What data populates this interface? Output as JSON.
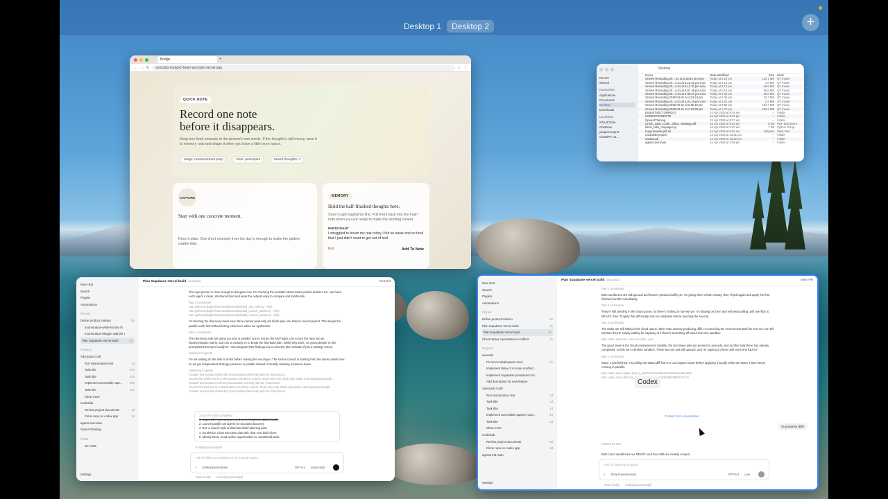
{
  "spaces": {
    "desktop1": "Desktop 1",
    "desktop2": "Desktop 2",
    "add": "+"
  },
  "browser": {
    "tab_title": "Bridge",
    "url": "avocado-nunigv1-team-avocado.vercel.app",
    "quick_note": {
      "pill": "QUICK NOTE",
      "title": "Record one note before it disappears.",
      "body": "Keep one lived example in the person's own words. If the thought is still messy, save it to memory now and shape it when you have a little more space.",
      "tags": [
        "Stage: reassessment prep",
        "Role: participant",
        "Saved thoughts: 7"
      ]
    },
    "capture": {
      "pill": "CAPTURE",
      "title": "Start with one concrete moment.",
      "body": "Keep it plain. One short example from the day is enough to make the pattern usable later."
    },
    "memory": {
      "pill": "MEMORY",
      "title": "Hold the half-finished thoughts here.",
      "body": "Save rough fragments first. Pull them back into the main note when you are ready to make the wording clearer.",
      "participant_label": "PARTICIPANT",
      "quote": "I struggled to brush my hair today I felt so weak and so tired that I just didn't want to get out of bed",
      "input_text": "test",
      "add_button": "Add To Note"
    }
  },
  "finder": {
    "title": "Desktop",
    "sidebar": [
      {
        "label": "Recent",
        "type": "item"
      },
      {
        "label": "Shared",
        "type": "item"
      },
      {
        "label": "Favourites",
        "type": "section"
      },
      {
        "label": "Applications",
        "type": "item"
      },
      {
        "label": "Documents",
        "type": "item"
      },
      {
        "label": "Desktop",
        "type": "selected"
      },
      {
        "label": "Downloads",
        "type": "item"
      },
      {
        "label": "Locations",
        "type": "section"
      },
      {
        "label": "iCloud Drive",
        "type": "item"
      },
      {
        "label": "OneDrive",
        "type": "item"
      },
      {
        "label": "jacquesresprot",
        "type": "item"
      },
      {
        "label": "ChatGPT Us...",
        "type": "item"
      }
    ],
    "columns": [
      "Name",
      "Date Modified",
      "Size",
      "Kind"
    ],
    "rows": [
      [
        "Screen Recording 20...-21 at 5.16.54 pm.mov",
        "Today at 5:20 pm",
        "132.1 MB",
        "QT movie"
      ],
      [
        "Screen Recording 20...4-21 at 5.16.21 pm.mov",
        "Today at 5:18 pm",
        "4.6 MB",
        "QT movie"
      ],
      [
        "Screen Recording 20...4-21 at 5.11.15 pm.mov",
        "Today at 5:13 pm",
        "56.6 MB",
        "QT movie"
      ],
      [
        "Screen Recording 20...4-21 at 5.07.49 pm.mov",
        "Today at 5:10 pm",
        "66.8 MB",
        "QT movie"
      ],
      [
        "Screen Recording 20...4-21 at 4.38.47 pm.mov",
        "Today at 4:40 pm",
        "26.6 MB",
        "QT movie"
      ],
      [
        "Screen Recording 2026-04-21 at 4.33.24 pm",
        "Today at 4:35 pm",
        "33.7 MB",
        "QT movie"
      ],
      [
        "Screen Recording 20...4-21 at 3.01.19 pm.mov",
        "Today at 3:01 pm",
        "2.2 MB",
        "QT movie"
      ],
      [
        "Screen Recording 2026-04-21 at 2.35.19 pm",
        "Today at 2:59 pm",
        "234.7 MB",
        "QT movie"
      ],
      [
        "Screen Recording 2026-04-21 at 1.34.30 pm",
        "Today at 1:47 pm",
        "299.2 MB",
        "QT movie"
      ],
      [
        "EIGENTVECTORROOT",
        "14 Apr 2026 at 8:18 am",
        "--",
        "Folder"
      ],
      [
        "CODEXPROJECTS",
        "15 Apr 2026 at 6:38 pm",
        "--",
        "Folder"
      ],
      [
        "OpenAITraining",
        "15 Apr 2026 at 9:37 am",
        "--",
        "Folder"
      ],
      [
        "Limon_Labs_Code...ollout_Strategy.pdf",
        "15 Apr 2026 at 9:33 am",
        "5 KB",
        "PDF Document"
      ],
      [
        "limon_labs_onepager.py",
        "15 Apr 2026 at 9:30 am",
        "7 KB",
        "Python Script"
      ],
      [
        "requirements.pdf.txt",
        "15 Apr 2026 at 9:30 am",
        "18 bytes",
        "Plain Text"
      ],
      [
        "Codexlab-project",
        "13 Apr 2026 at 12:51 pm",
        "--",
        "Folder"
      ],
      [
        "CodexLab",
        "13 Apr 2026 at 12:52 pm",
        "--",
        "Folder"
      ],
      [
        "agents.md-main",
        "15 Apr 2026 at 4:08 pm",
        "--",
        "Folder"
      ]
    ]
  },
  "codex_left": {
    "header_title": "Plan Supabase Vercel build",
    "header_sub": "avocado",
    "commit": "Commit",
    "sidebar": [
      {
        "label": "New chat",
        "type": "item"
      },
      {
        "label": "Search",
        "type": "item"
      },
      {
        "label": "Plugins",
        "type": "item"
      },
      {
        "label": "Automations",
        "type": "item"
      },
      {
        "label": "Pinned",
        "type": "section"
      },
      {
        "label": "Define product mission",
        "t": "5h",
        "type": "item"
      },
      {
        "label": "murmuration-white-hat the th",
        "t": "",
        "type": "indent"
      },
      {
        "label": "murmuration-blogger add the t",
        "t": "",
        "type": "indent"
      },
      {
        "label": "Plan Supabase Vercel build",
        "t": "1m",
        "type": "selected"
      },
      {
        "label": "Projects",
        "type": "section"
      },
      {
        "label": "Advocado Craft",
        "type": "item"
      },
      {
        "label": "Run Murmuration test",
        "t": "1d",
        "type": "indent"
      },
      {
        "label": "Task title",
        "t": "23h",
        "type": "indent"
      },
      {
        "label": "Task title",
        "t": "23h",
        "type": "indent"
      },
      {
        "label": "Implement accessible capt...",
        "t": "23h",
        "type": "indent"
      },
      {
        "label": "Task title",
        "t": "23h",
        "type": "indent"
      },
      {
        "label": "Show more",
        "type": "indent"
      },
      {
        "label": "Codexlab",
        "type": "item"
      },
      {
        "label": "Review project documents",
        "t": "1d",
        "type": "indent"
      },
      {
        "label": "Clone repo on codex app",
        "t": "2d",
        "type": "indent"
      },
      {
        "label": "agents.md-main",
        "type": "item"
      },
      {
        "label": "OpenAITraining",
        "type": "item"
      },
      {
        "label": "Chats",
        "type": "section"
      },
      {
        "label": "No chats",
        "type": "indent"
      }
    ],
    "settings": "Settings",
    "paragraphs": [
      "The repo picture is clear enough to delegate now. I'm checking the possible Murmuration packet builders so I can hand each agent a clean, structured brief and keep the outputs easy to compare and synthesize.",
      "Ran 3 commands",
      "Ran python3 plugins/murmuration/scripts/build_anti_brief.py --help",
      "Ran python3 plugins/murmuration/scripts/build_council_packet.py --help",
      "Ran python3 plugins/murmuration/scripts/build_council_packet.py --help",
      "I'm freezing the discovery lanes now: three narrow-read-only ant briefs plus one shared council packet. That keeps the parallel work fast without losing coherence when we synthesize.",
      "Ran 4 commands",
      "The discovery ants are going out now in parallel: one to extract the MVP path, one to turn the repo into an implementation matrix, and one to actively try to break the fast-build plan. While they work, I'm going deeper on the prompt/schema layer locally so I can integrate their findings into a concrete plan instead of just a strategy memo.",
      "Spawned 3 agents",
      "I'm not waiting on the ants to finish before moving the next layer. The six-hat council is starting from the same packet now so we get independent strategic pressure in parallel instead of serially stacking ourselves down.",
      "Spawning 6 agents",
      "Created murmuration-white-hat (murmuration-white-hat) with the instructions:",
      "You are the White Hat in a Murmuration Six Bono council. Read-only only. Work only inside /Users/jacquesvanpijl/...",
      "Created murmuration-red-hat (murmuration-red-hat) with the instructions:",
      "You are the Red Hat in a Murmuration Six Bono council. Read-only only. Work only inside /Users/jacquesvanpijl/...",
      "Created murmuration-black-hat (murmuration-black-hat) with the instructions:"
    ],
    "tasks_header": "1 out of 6 tasks completed",
    "tasks": [
      "1. Inspect the repo structure and current implementation locally",
      "2. Launch parallel ant agents for bounded discovery",
      "3. Run a council-style architecture/build planning pass",
      "4. Synthesize a fast execution plan with clear next build slices",
      "5. Identify future cloud worker opportunities for asset/build tasks"
    ],
    "background_agents": "9 background agents",
    "composer_placeholder": "Ask for follow-up changes or @ to tag an agent",
    "composer_perm": "Default permissions",
    "model": "GPT-5.4",
    "effort": "Extra High",
    "status_local": "Work locally",
    "status_branch": "codex/jacquesvanpijl"
  },
  "codex_right": {
    "header_title": "Plan Supabase Vercel build",
    "header_sub": "avocado",
    "view_pr": "View PR",
    "sidebar": [
      {
        "label": "New chat",
        "type": "item"
      },
      {
        "label": "Search",
        "type": "item"
      },
      {
        "label": "Plugins",
        "type": "item"
      },
      {
        "label": "Automations",
        "type": "item"
      },
      {
        "label": "Pinned",
        "type": "section"
      },
      {
        "label": "Define product mission",
        "t": "5h",
        "type": "item"
      },
      {
        "label": "Plan Supabase Vercel build",
        "t": "2h",
        "type": "item"
      },
      {
        "label": "Plan Supabase Vercel build",
        "t": "2h",
        "type": "selected"
      },
      {
        "label": "Check Wave 3 persistence conflicts",
        "t": "1h",
        "type": "item"
      },
      {
        "label": "Projects",
        "type": "section"
      },
      {
        "label": "avocado",
        "type": "item"
      },
      {
        "label": "Fix Vercel deployment error",
        "t": "1h",
        "type": "indent"
      },
      {
        "label": "Implement Wave 3 AI route scaffold...",
        "t": "",
        "type": "indent"
      },
      {
        "label": "Implement Supabase persistence for...",
        "t": "",
        "type": "indent"
      },
      {
        "label": "Add description for new feature",
        "t": "",
        "type": "indent"
      },
      {
        "label": "Advocado Craft",
        "type": "item"
      },
      {
        "label": "Run Murmuration test",
        "t": "1d",
        "type": "indent"
      },
      {
        "label": "Task title",
        "t": "1d",
        "type": "indent"
      },
      {
        "label": "Task title",
        "t": "1d",
        "type": "indent"
      },
      {
        "label": "Implement accessible capture route...",
        "t": "1d",
        "type": "indent"
      },
      {
        "label": "Task title",
        "t": "1d",
        "type": "indent"
      },
      {
        "label": "Show more",
        "type": "indent"
      },
      {
        "label": "Codexlab",
        "type": "item"
      },
      {
        "label": "Review project documents",
        "t": "8d",
        "type": "indent"
      },
      {
        "label": "Clone repo on codex app",
        "t": "8d",
        "type": "indent"
      },
      {
        "label": "agents.md-main",
        "type": "item"
      }
    ],
    "settings": "Settings",
    "paragraphs": [
      "Ran 2 commands",
      "Both sandboxes are still queued and haven't produced diffs yet. I'm giving them a little runway, then I'll poll again and apply the first finished bundle immediately.",
      "Ran 3 commands",
      "They're still pending in the cloud queue, so there's nothing to harvest yet. I'm staying on them and will keep polling until one flips to READY, then I'll apply that diff locally and run validation before touching the second.",
      "Ran 3 commands",
      "The tasks are still sitting in the cloud queue rather than actively producing diffs. I'm checking the environment task list next so I can tell whether they're simply waiting for capacity or if there's something off about this new sandbox.",
      "Ran codex cloud list --env avocado --json",
      "The good news is the cloud environment is healthy: the two Wave jobs are present in avocado, and another task there has already completed, so this isn't a broken sandbox. These two are just still queued, and I'm staying on them until one turns READY.",
      "Ran 3 commands",
      "Wave 2 just finished. I'm pulling the status diff first so I can inspect scope before applying it locally, while the Wave 3 lane keeps running in parallel.",
      "Ran codex cloud status task_b_69e70d13dec8652a51029ea2edac469c",
      "Ran codex cloud diff task_b_69e70d13e590d2a93a0d929986f17e17c"
    ],
    "forked": "Forked from conversation",
    "summarise": "Summarise diffs",
    "worked_for": "Worked for 53s",
    "final_line": "Both cloud sandboxes are READY, and their diffs are cleanly scoped.",
    "composer_placeholder": "Ask for follow-up changes",
    "composer_perm": "Default permissions",
    "model": "GPT-5.4",
    "effort": "Low",
    "status_local": "Work locally",
    "status_branch": "codex/jacquesvanpijl"
  },
  "tooltip": "Codex"
}
